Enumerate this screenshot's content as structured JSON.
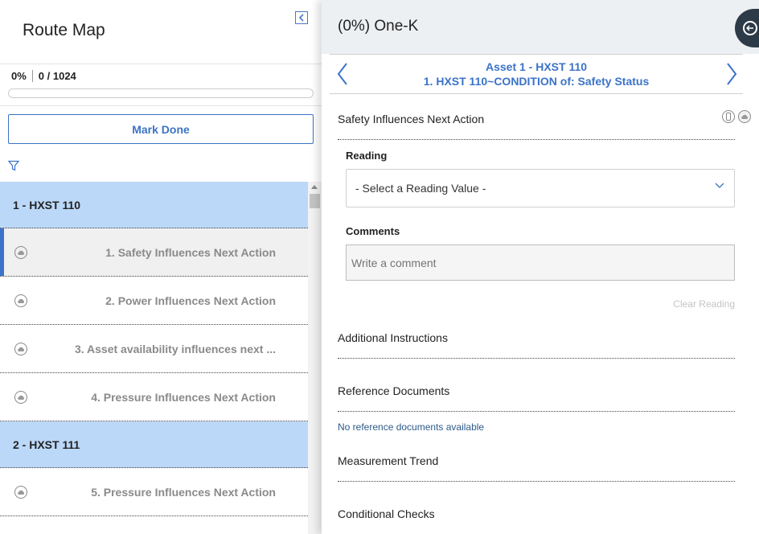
{
  "left_panel": {
    "title": "Route Map",
    "progress": {
      "percent_label": "0%",
      "count_label": "0 / 1024",
      "fraction": 0.0
    },
    "mark_done_label": "Mark Done",
    "list": [
      {
        "kind": "group",
        "label": "1 - HXST 110"
      },
      {
        "kind": "step",
        "label": "1. Safety Influences Next Action",
        "active": true
      },
      {
        "kind": "step",
        "label": "2. Power Influences Next Action"
      },
      {
        "kind": "step",
        "label": "3. Asset availability influences next ..."
      },
      {
        "kind": "step",
        "label": "4. Pressure Influences Next Action"
      },
      {
        "kind": "group",
        "label": "2 - HXST 111"
      },
      {
        "kind": "step",
        "label": "5. Pressure Influences Next Action"
      }
    ]
  },
  "right_panel": {
    "title": "(0%) One-K",
    "nav": {
      "line1": "Asset 1 - HXST 110",
      "line2": "1. HXST 110~CONDITION of: Safety Status"
    },
    "step_title": "Safety Influences Next Action",
    "reading_label": "Reading",
    "reading_select": "- Select a Reading Value -",
    "comments_label": "Comments",
    "comments_placeholder": "Write a comment",
    "clear_reading": "Clear Reading",
    "sections": {
      "additional_instructions": "Additional Instructions",
      "reference_documents": "Reference Documents",
      "no_docs": "No reference documents available",
      "measurement_trend": "Measurement Trend",
      "conditional_checks": "Conditional Checks"
    }
  },
  "colors": {
    "accent": "#3b73c8",
    "group_bg": "#bcd8f8",
    "header_bg": "#edf0f3",
    "side_tab": "#2d3a47"
  },
  "icons": [
    "collapse-icon",
    "filter-icon",
    "cloud-icon",
    "chevron-left-icon",
    "chevron-right-icon",
    "chevron-down-icon",
    "mobile-icon",
    "exit-icon"
  ]
}
